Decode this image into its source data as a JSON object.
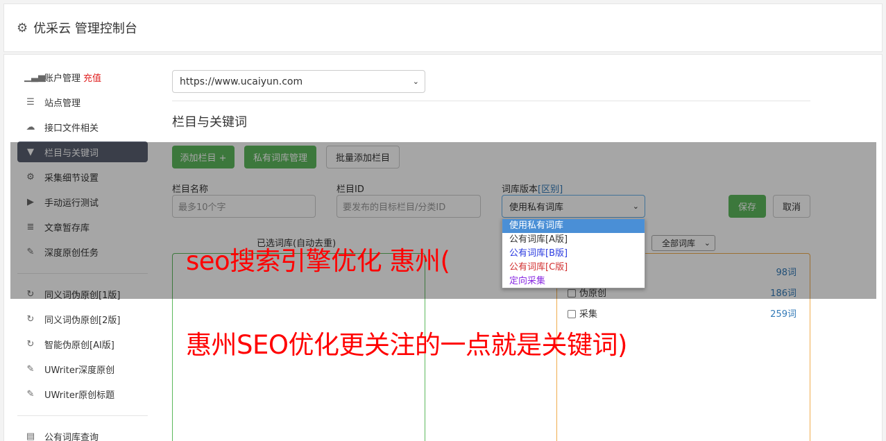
{
  "header": {
    "title": "优采云 管理控制台",
    "icon": "gear-icon"
  },
  "sidebar": {
    "items": [
      {
        "label": "账户管理",
        "badge": "充值",
        "icon": "bar-chart-icon",
        "glyph": "▁▃▅"
      },
      {
        "label": "站点管理",
        "icon": "server-icon",
        "glyph": "☰"
      },
      {
        "label": "接口文件相关",
        "icon": "cloud-upload-icon",
        "glyph": "☁"
      },
      {
        "label": "栏目与关键词",
        "icon": "filter-icon",
        "glyph": "▼",
        "active": true
      },
      {
        "label": "采集细节设置",
        "icon": "cogs-icon",
        "glyph": "⚙"
      },
      {
        "label": "手动运行测试",
        "icon": "play-icon",
        "glyph": "▶"
      },
      {
        "label": "文章暂存库",
        "icon": "database-icon",
        "glyph": "≣"
      },
      {
        "label": "深度原创任务",
        "icon": "edit-icon",
        "glyph": "✎"
      }
    ],
    "items2": [
      {
        "label": "同义词伪原创[1版]",
        "icon": "refresh-icon",
        "glyph": "↻"
      },
      {
        "label": "同义词伪原创[2版]",
        "icon": "refresh-icon",
        "glyph": "↻"
      },
      {
        "label": "智能伪原创[AI版]",
        "icon": "refresh-icon",
        "glyph": "↻"
      },
      {
        "label": "UWriter深度原创",
        "icon": "edit-icon",
        "glyph": "✎"
      },
      {
        "label": "UWriter原创标题",
        "icon": "edit-icon",
        "glyph": "✎"
      }
    ],
    "items3": [
      {
        "label": "公有词库查询",
        "icon": "book-icon",
        "glyph": "▤"
      }
    ]
  },
  "main": {
    "site_select": "https://www.ucaiyun.com",
    "section_title": "栏目与关键词",
    "buttons": {
      "add_column": "添加栏目 +",
      "private_lib": "私有词库管理",
      "batch_add": "批量添加栏目",
      "save": "保存",
      "cancel": "取消"
    },
    "fields": {
      "column_name_label": "栏目名称",
      "column_name_placeholder": "最多10个字",
      "column_id_label": "栏目ID",
      "column_id_placeholder": "要发布的目标栏目/分类ID",
      "lib_version_label": "词库版本",
      "lib_version_link": "[区别]",
      "lib_version_value": "使用私有词库"
    },
    "dropdown_options": [
      "使用私有词库",
      "公有词库[A版]",
      "公有词库[B版]",
      "公有词库[C版]",
      "定向采集"
    ],
    "left_box_caption": "已选词库(自动去重)",
    "all_libs_select": "全部词库",
    "word_rows": [
      {
        "label": "",
        "count": "98词"
      },
      {
        "label": "伪原创",
        "count": "186词"
      },
      {
        "label": "采集",
        "count": "259词"
      }
    ]
  },
  "watermark": {
    "line1": "seo搜索引擎优化 惠州(",
    "line2": "惠州SEO优化更关注的一点就是关键词)"
  },
  "colors": {
    "accent_green": "#5cb85c",
    "active_nav": "#5a6070",
    "link_blue": "#337ab7",
    "watermark_red": "#ff0000"
  }
}
